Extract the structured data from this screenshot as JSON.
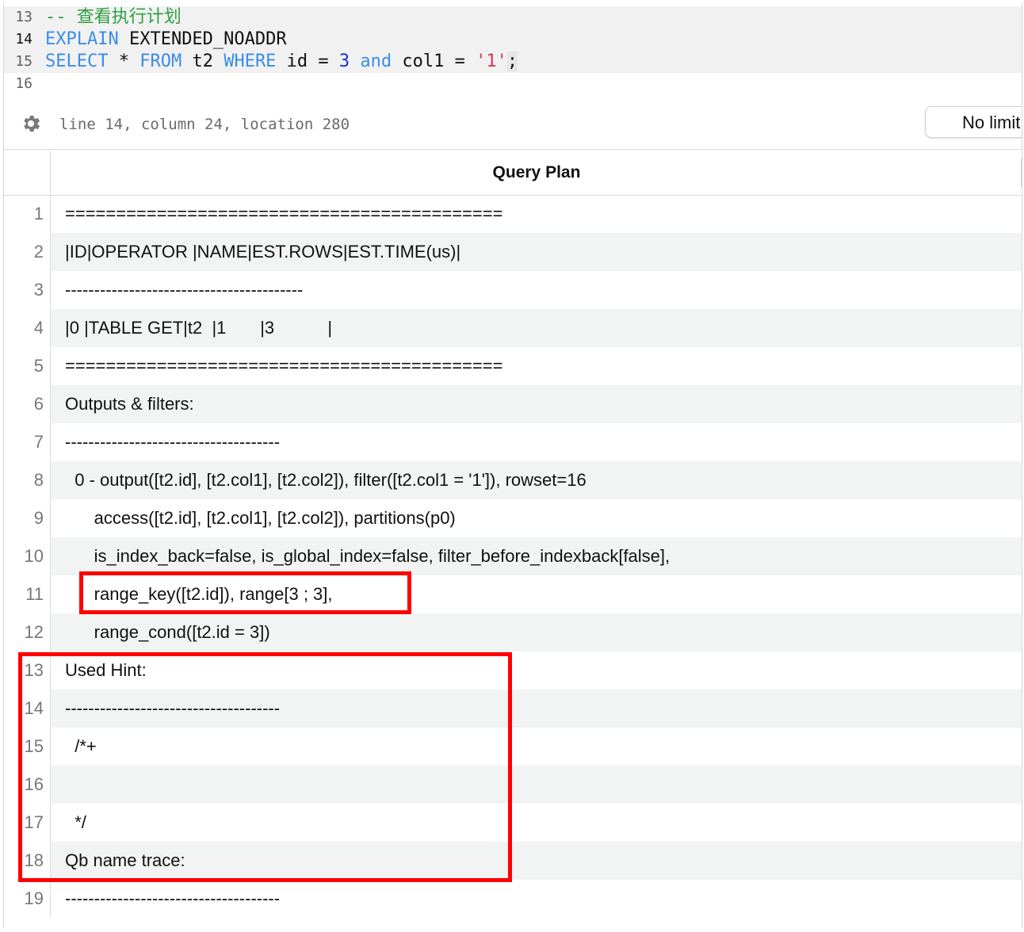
{
  "editor": {
    "lines": [
      {
        "num": "13",
        "tokens": [
          {
            "text": "-- 查看执行计划",
            "kind": "c"
          }
        ]
      },
      {
        "num": "14",
        "tokens": [
          {
            "text": "EXPLAIN",
            "kind": "k"
          },
          {
            "text": " EXTENDED_NOADDR",
            "kind": "t"
          }
        ]
      },
      {
        "num": "15",
        "tokens": [
          {
            "text": "SELECT",
            "kind": "k"
          },
          {
            "text": " * ",
            "kind": "t"
          },
          {
            "text": "FROM",
            "kind": "k"
          },
          {
            "text": " t2 ",
            "kind": "t"
          },
          {
            "text": "WHERE",
            "kind": "k"
          },
          {
            "text": " id = ",
            "kind": "t"
          },
          {
            "text": "3",
            "kind": "n"
          },
          {
            "text": " ",
            "kind": "t"
          },
          {
            "text": "and",
            "kind": "k"
          },
          {
            "text": " col1 = ",
            "kind": "t"
          },
          {
            "text": "'1'",
            "kind": "s"
          },
          {
            "text": ";",
            "kind": "t"
          }
        ]
      },
      {
        "num": "16",
        "tokens": []
      }
    ]
  },
  "status": {
    "position": "line 14, column 24, location 280",
    "limit_label": "No limit",
    "settings_icon": "gear-icon"
  },
  "results": {
    "column_header": "Query Plan",
    "rows": [
      {
        "num": "1",
        "text": "==========================================="
      },
      {
        "num": "2",
        "text": "|ID|OPERATOR |NAME|EST.ROWS|EST.TIME(us)|"
      },
      {
        "num": "3",
        "text": "-----------------------------------------"
      },
      {
        "num": "4",
        "text": "|0 |TABLE GET|t2  |1       |3           |"
      },
      {
        "num": "5",
        "text": "==========================================="
      },
      {
        "num": "6",
        "text": "Outputs & filters:"
      },
      {
        "num": "7",
        "text": "-------------------------------------"
      },
      {
        "num": "8",
        "text": "  0 - output([t2.id], [t2.col1], [t2.col2]), filter([t2.col1 = '1']), rowset=16"
      },
      {
        "num": "9",
        "text": "      access([t2.id], [t2.col1], [t2.col2]), partitions(p0)"
      },
      {
        "num": "10",
        "text": "      is_index_back=false, is_global_index=false, filter_before_indexback[false],"
      },
      {
        "num": "11",
        "text": "      range_key([t2.id]), range[3 ; 3],"
      },
      {
        "num": "12",
        "text": "      range_cond([t2.id = 3])"
      },
      {
        "num": "13",
        "text": "Used Hint:"
      },
      {
        "num": "14",
        "text": "-------------------------------------"
      },
      {
        "num": "15",
        "text": "  /*+"
      },
      {
        "num": "16",
        "text": ""
      },
      {
        "num": "17",
        "text": "  */"
      },
      {
        "num": "18",
        "text": "Qb name trace:"
      },
      {
        "num": "19",
        "text": "-------------------------------------"
      }
    ]
  },
  "colors": {
    "keyword": "#3a8ee6",
    "comment": "#2ea043",
    "number": "#1f2fd8",
    "string": "#d23a5b",
    "annotation": "#ff0000",
    "row_alt": "#f2f3f3"
  }
}
